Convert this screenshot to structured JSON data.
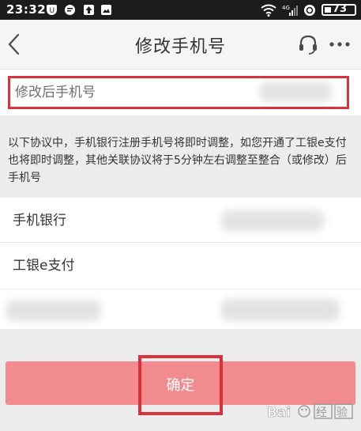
{
  "status_bar": {
    "time": "23:32",
    "battery": "73",
    "left_icons": [
      "shield-icon",
      "chat-icon",
      "upload-icon",
      "photo-icon"
    ],
    "right_icons": [
      "wifi-icon",
      "signal-icon",
      "sync-icon",
      "battery-icon"
    ]
  },
  "header": {
    "title": "修改手机号",
    "back_icon": "chevron-left-icon",
    "support_icon": "headset-icon",
    "more_icon": "more-dots-icon"
  },
  "phone_field": {
    "placeholder": "修改后手机号",
    "value": ""
  },
  "notice": {
    "text": "以下协议中，手机银行注册手机号将即时调整，如您开通了工银e支付也将即时调整，其他关联协议将于5分钟左右调整至整合（或修改）后手机号"
  },
  "agreements": [
    {
      "label": "手机银行"
    },
    {
      "label": "工银e支付"
    }
  ],
  "confirm_button": {
    "label": "确定"
  },
  "colors": {
    "accent_red": "#d9323c",
    "button_pink": "#f28b8e",
    "header_bg": "#f5f5f5",
    "page_bg": "#ececec"
  }
}
